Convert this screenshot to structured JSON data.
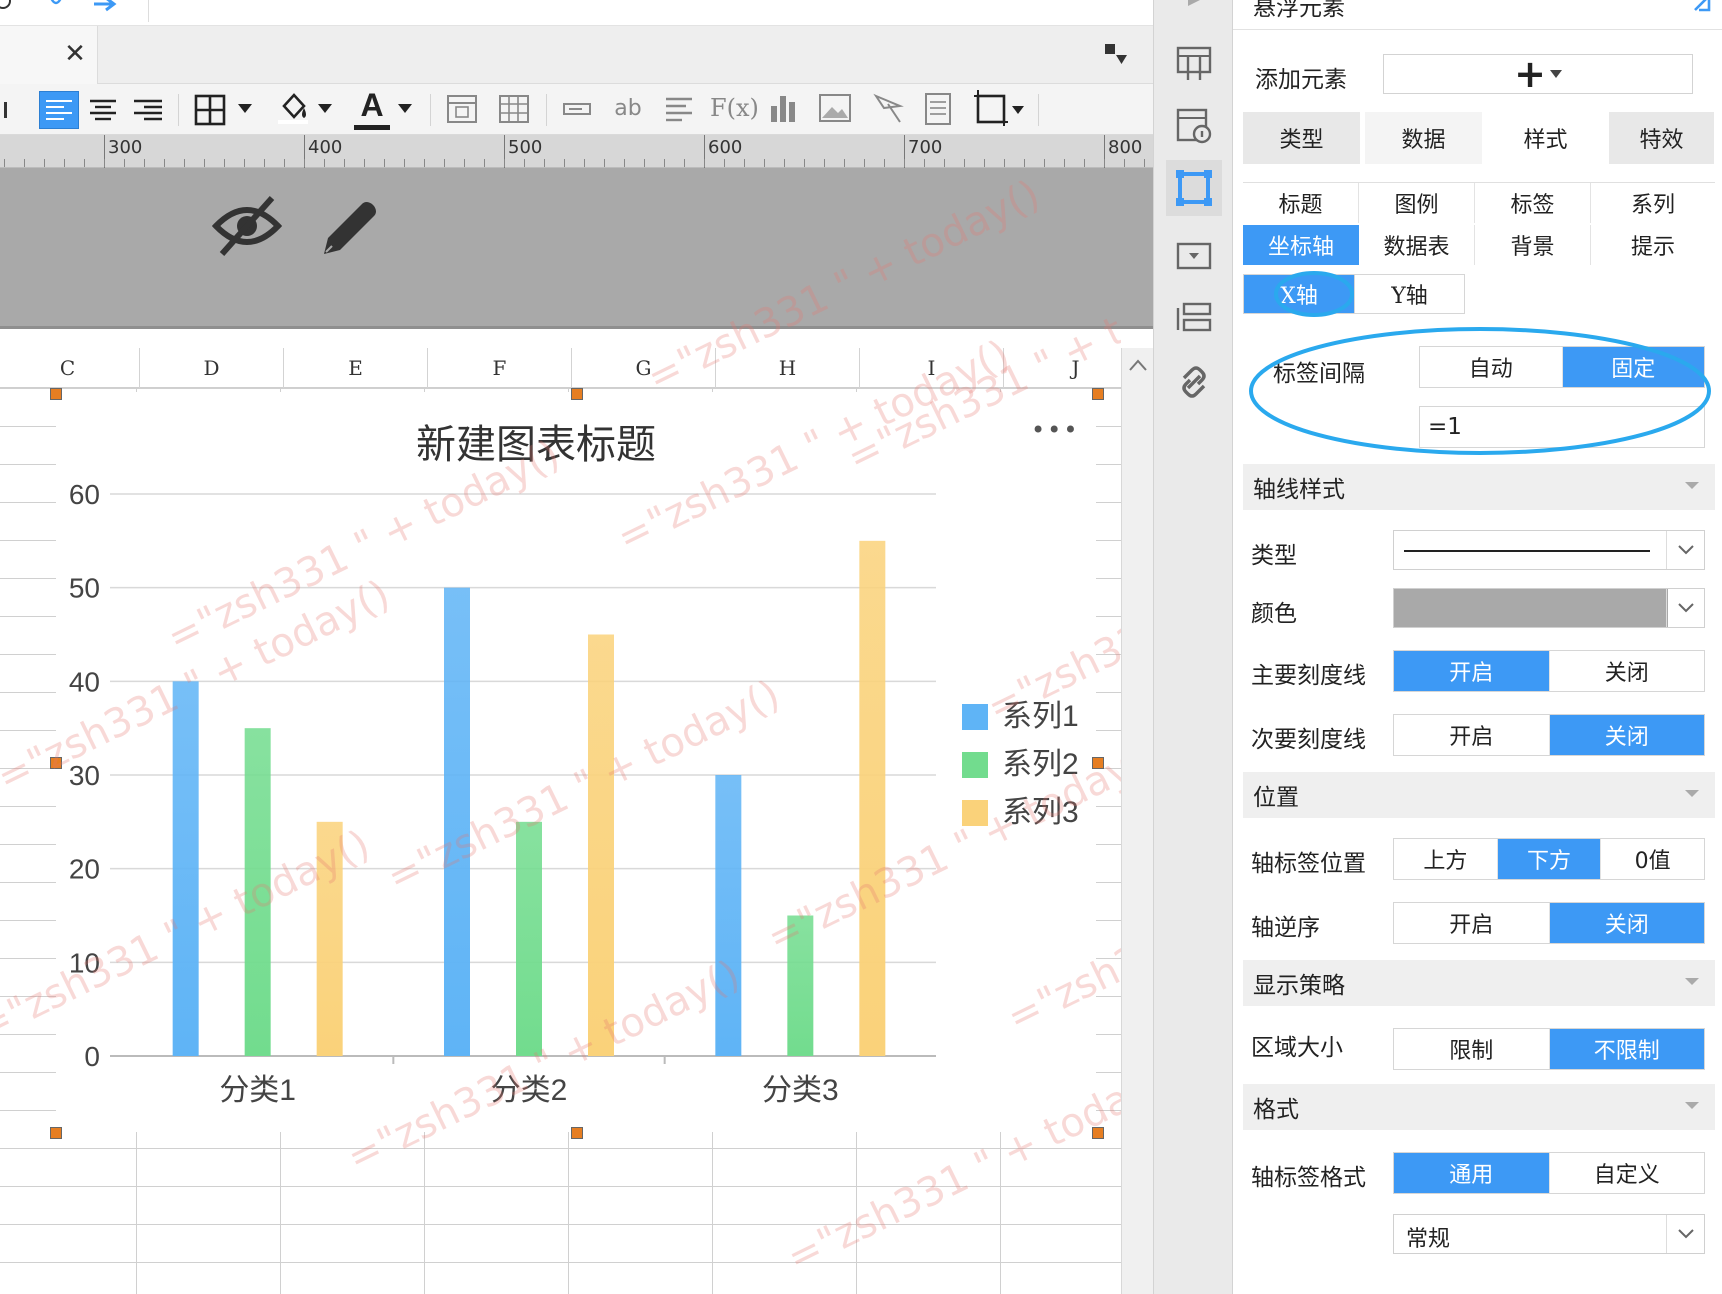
{
  "toolbar": {
    "icons": [
      "align-left-icon",
      "align-center-icon",
      "align-right-icon",
      "border-icon",
      "fill-color-icon",
      "font-color-icon",
      "merge-cells-icon",
      "table-icon",
      "text-field-icon",
      "ab-label-icon",
      "list-icon",
      "formula-icon",
      "bar-chart-icon",
      "image-icon",
      "slash-icon",
      "document-icon",
      "frame-icon"
    ],
    "ab_label": "ab",
    "font_color_letter": "A",
    "formula_label": "F(x)"
  },
  "ruler": {
    "labels": [
      "300",
      "400",
      "500",
      "600",
      "700",
      "800"
    ]
  },
  "columns": [
    "C",
    "D",
    "E",
    "F",
    "G",
    "H",
    "I",
    "J"
  ],
  "watermark_text": "=\"zsh331 \" + today()",
  "chart_data": {
    "type": "bar",
    "title": "新建图表标题",
    "categories": [
      "分类1",
      "分类2",
      "分类3"
    ],
    "series": [
      {
        "name": "系列1",
        "values": [
          40,
          50,
          30
        ],
        "color": "#5fb4f6"
      },
      {
        "name": "系列2",
        "values": [
          35,
          25,
          15
        ],
        "color": "#72dc8e"
      },
      {
        "name": "系列3",
        "values": [
          25,
          45,
          55
        ],
        "color": "#fad27a"
      }
    ],
    "yticks": [
      "0",
      "10",
      "20",
      "30",
      "40",
      "50",
      "60"
    ],
    "ylim": [
      0,
      60
    ],
    "grid": true,
    "legend_position": "right",
    "more_label": "•••"
  },
  "panel": {
    "header_title": "悬浮元素",
    "add_element_label": "添加元素",
    "add_button_glyph": "+",
    "main_tabs": [
      "类型",
      "数据",
      "样式",
      "特效"
    ],
    "sub_tabs_row1": [
      "标题",
      "图例",
      "标签",
      "系列"
    ],
    "sub_tabs_row2": [
      "坐标轴",
      "数据表",
      "背景",
      "提示"
    ],
    "axis_tabs": [
      "X轴",
      "Y轴"
    ],
    "label_interval": {
      "label": "标签间隔",
      "options": [
        "自动",
        "固定"
      ],
      "selected": "固定",
      "value": "=1"
    },
    "axis_style_section": "轴线样式",
    "type_label": "类型",
    "color_label": "颜色",
    "major_tick": {
      "label": "主要刻度线",
      "options": [
        "开启",
        "关闭"
      ],
      "selected": "开启"
    },
    "minor_tick": {
      "label": "次要刻度线",
      "options": [
        "开启",
        "关闭"
      ],
      "selected": "关闭"
    },
    "position_section": "位置",
    "label_position": {
      "label": "轴标签位置",
      "options": [
        "上方",
        "下方",
        "0值"
      ],
      "selected": "下方"
    },
    "reverse": {
      "label": "轴逆序",
      "options": [
        "开启",
        "关闭"
      ],
      "selected": "关闭"
    },
    "display_section": "显示策略",
    "area_size": {
      "label": "区域大小",
      "options": [
        "限制",
        "不限制"
      ],
      "selected": "不限制"
    },
    "format_section": "格式",
    "label_format": {
      "label": "轴标签格式",
      "options": [
        "通用",
        "自定义"
      ],
      "selected": "通用"
    },
    "format_select_value": "常规"
  },
  "colors": {
    "accent": "#3d99f5",
    "highlight_ring": "#2aa9ee"
  }
}
